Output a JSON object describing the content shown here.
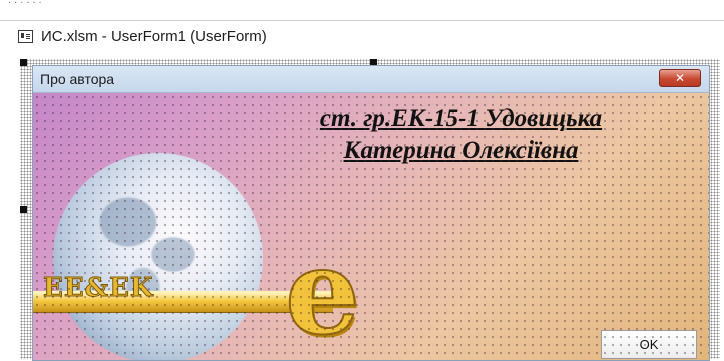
{
  "editor": {
    "title": "ИС.xlsm - UserForm1 (UserForm)",
    "icon": "userform-icon"
  },
  "userform": {
    "title": "Про автора",
    "close_icon": "close-icon",
    "close_glyph": "✕",
    "author_line1": "ст. гр.ЕК-15-1 Удовицька",
    "author_line2": "Катерина Олексіївна",
    "logo": {
      "text": "EE&EK",
      "letter": "e"
    },
    "ok_label": "OK"
  },
  "colors": {
    "close_button": "#c74a33",
    "gradient_start": "#c486c8",
    "gradient_end": "#e2b57a",
    "logo_gold": "#f2c33a"
  }
}
